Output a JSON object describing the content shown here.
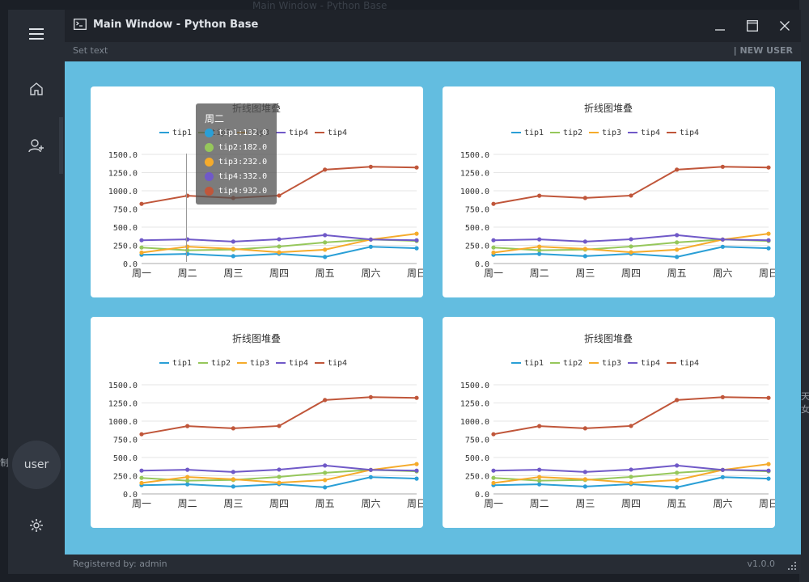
{
  "window": {
    "title": "Main Window - Python Base",
    "subbar_left": "Set text",
    "subbar_right": "| NEW USER",
    "footer_left": "Registered by: admin",
    "footer_right": "v1.0.0"
  },
  "desktop": {
    "bg_title": "Main Window - Python Base",
    "edge_right": "天女",
    "edge_left": "制"
  },
  "sidebar": {
    "user_label": "user",
    "icons": [
      "menu-icon",
      "home-icon",
      "add-user-icon",
      "settings-icon"
    ]
  },
  "colors": {
    "accent_bg": "#63bde0",
    "tip1": "#2a9fd6",
    "tip2": "#96c75b",
    "tip3": "#f5ab2b",
    "tip4a": "#7059c8",
    "tip4b": "#c0563a"
  },
  "tooltip": {
    "title": "周二",
    "rows": [
      "tip1:132.0",
      "tip2:182.0",
      "tip3:232.0",
      "tip4:332.0",
      "tip4:932.0"
    ]
  },
  "chart_data": [
    {
      "type": "line",
      "title": "折线图堆叠",
      "categories": [
        "周一",
        "周二",
        "周三",
        "周四",
        "周五",
        "周六",
        "周日"
      ],
      "ylim": [
        0,
        1500
      ],
      "yticks": [
        "0.0",
        "250.0",
        "500.0",
        "750.0",
        "1000.0",
        "1250.0",
        "1500.0"
      ],
      "legend": "top-center",
      "series": [
        {
          "name": "tip1",
          "values": [
            120,
            132,
            101,
            134,
            90,
            230,
            210
          ]
        },
        {
          "name": "tip2",
          "values": [
            220,
            182,
            191,
            234,
            290,
            330,
            310
          ]
        },
        {
          "name": "tip3",
          "values": [
            150,
            232,
            201,
            154,
            190,
            330,
            410
          ]
        },
        {
          "name": "tip4",
          "values": [
            320,
            332,
            301,
            334,
            390,
            330,
            320
          ]
        },
        {
          "name": "tip4",
          "values": [
            820,
            932,
            901,
            934,
            1290,
            1330,
            1320
          ]
        }
      ]
    },
    {
      "type": "line",
      "title": "折线图堆叠",
      "categories": [
        "周一",
        "周二",
        "周三",
        "周四",
        "周五",
        "周六",
        "周日"
      ],
      "ylim": [
        0,
        1500
      ],
      "yticks": [
        "0.0",
        "250.0",
        "500.0",
        "750.0",
        "1000.0",
        "1250.0",
        "1500.0"
      ],
      "legend": "top-center",
      "series": [
        {
          "name": "tip1",
          "values": [
            120,
            132,
            101,
            134,
            90,
            230,
            210
          ]
        },
        {
          "name": "tip2",
          "values": [
            220,
            182,
            191,
            234,
            290,
            330,
            310
          ]
        },
        {
          "name": "tip3",
          "values": [
            150,
            232,
            201,
            154,
            190,
            330,
            410
          ]
        },
        {
          "name": "tip4",
          "values": [
            320,
            332,
            301,
            334,
            390,
            330,
            320
          ]
        },
        {
          "name": "tip4",
          "values": [
            820,
            932,
            901,
            934,
            1290,
            1330,
            1320
          ]
        }
      ]
    },
    {
      "type": "line",
      "title": "折线图堆叠",
      "categories": [
        "周一",
        "周二",
        "周三",
        "周四",
        "周五",
        "周六",
        "周日"
      ],
      "ylim": [
        0,
        1500
      ],
      "yticks": [
        "0.0",
        "250.0",
        "500.0",
        "750.0",
        "1000.0",
        "1250.0",
        "1500.0"
      ],
      "legend": "top-center",
      "series": [
        {
          "name": "tip1",
          "values": [
            120,
            132,
            101,
            134,
            90,
            230,
            210
          ]
        },
        {
          "name": "tip2",
          "values": [
            220,
            182,
            191,
            234,
            290,
            330,
            310
          ]
        },
        {
          "name": "tip3",
          "values": [
            150,
            232,
            201,
            154,
            190,
            330,
            410
          ]
        },
        {
          "name": "tip4",
          "values": [
            320,
            332,
            301,
            334,
            390,
            330,
            320
          ]
        },
        {
          "name": "tip4",
          "values": [
            820,
            932,
            901,
            934,
            1290,
            1330,
            1320
          ]
        }
      ]
    },
    {
      "type": "line",
      "title": "折线图堆叠",
      "categories": [
        "周一",
        "周二",
        "周三",
        "周四",
        "周五",
        "周六",
        "周日"
      ],
      "ylim": [
        0,
        1500
      ],
      "yticks": [
        "0.0",
        "250.0",
        "500.0",
        "750.0",
        "1000.0",
        "1250.0",
        "1500.0"
      ],
      "legend": "top-center",
      "series": [
        {
          "name": "tip1",
          "values": [
            120,
            132,
            101,
            134,
            90,
            230,
            210
          ]
        },
        {
          "name": "tip2",
          "values": [
            220,
            182,
            191,
            234,
            290,
            330,
            310
          ]
        },
        {
          "name": "tip3",
          "values": [
            150,
            232,
            201,
            154,
            190,
            330,
            410
          ]
        },
        {
          "name": "tip4",
          "values": [
            320,
            332,
            301,
            334,
            390,
            330,
            320
          ]
        },
        {
          "name": "tip4",
          "values": [
            820,
            932,
            901,
            934,
            1290,
            1330,
            1320
          ]
        }
      ]
    }
  ]
}
